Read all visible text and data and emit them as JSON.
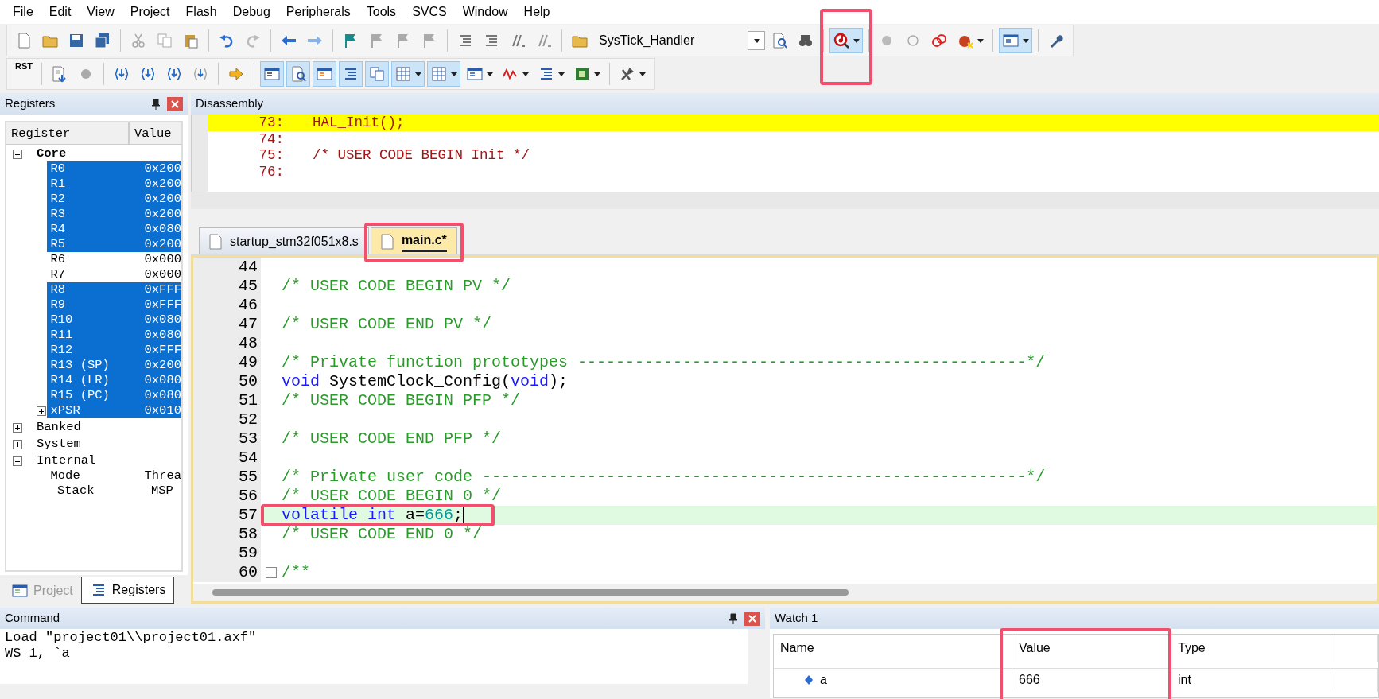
{
  "menu": [
    "File",
    "Edit",
    "View",
    "Project",
    "Flash",
    "Debug",
    "Peripherals",
    "Tools",
    "SVCS",
    "Window",
    "Help"
  ],
  "toolbar_1": [
    {
      "kind": "new"
    },
    {
      "kind": "open"
    },
    {
      "kind": "save"
    },
    {
      "kind": "saveall"
    },
    {
      "kind": "separator"
    },
    {
      "kind": "cut"
    },
    {
      "kind": "copy"
    },
    {
      "kind": "paste"
    },
    {
      "kind": "separator"
    },
    {
      "kind": "undo"
    },
    {
      "kind": "redo"
    },
    {
      "kind": "separator"
    },
    {
      "kind": "back"
    },
    {
      "kind": "forward"
    },
    {
      "kind": "separator"
    },
    {
      "kind": "bookmark"
    },
    {
      "kind": "bookmarkprev"
    },
    {
      "kind": "bookmarknext"
    },
    {
      "kind": "bookmarkclear"
    },
    {
      "kind": "separator"
    },
    {
      "kind": "indent"
    },
    {
      "kind": "outdent"
    },
    {
      "kind": "comment"
    },
    {
      "kind": "uncomment"
    },
    {
      "kind": "separator"
    },
    {
      "kind": "findfiles"
    },
    {
      "kind": "combo",
      "value": "SysTick_Handler"
    },
    {
      "kind": "find"
    },
    {
      "kind": "incremental"
    },
    {
      "kind": "separator"
    },
    {
      "kind": "debug",
      "on": true,
      "dropdown": true,
      "highlighted": true
    },
    {
      "kind": "separator"
    },
    {
      "kind": "bpinsert"
    },
    {
      "kind": "bpenable"
    },
    {
      "kind": "bpdisable"
    },
    {
      "kind": "bpkill",
      "dropdown": true
    },
    {
      "kind": "separator"
    },
    {
      "kind": "layout",
      "on": true,
      "dropdown": true
    },
    {
      "kind": "separator"
    },
    {
      "kind": "wrench"
    }
  ],
  "toolbar_2": [
    {
      "kind": "reset",
      "label": "RST"
    },
    {
      "kind": "separator"
    },
    {
      "kind": "run"
    },
    {
      "kind": "stop"
    },
    {
      "kind": "separator"
    },
    {
      "kind": "stepinto"
    },
    {
      "kind": "stepover"
    },
    {
      "kind": "stepout"
    },
    {
      "kind": "runcursor"
    },
    {
      "kind": "separator"
    },
    {
      "kind": "nextstatement"
    },
    {
      "kind": "separator"
    },
    {
      "kind": "cmdwindow",
      "on": true
    },
    {
      "kind": "disasm",
      "on": true
    },
    {
      "kind": "symbols",
      "on": true
    },
    {
      "kind": "registers",
      "on": true
    },
    {
      "kind": "callstack",
      "on": true
    },
    {
      "kind": "watch",
      "on": true,
      "dropdown": true
    },
    {
      "kind": "memory",
      "on": true,
      "dropdown": true
    },
    {
      "kind": "serial",
      "dropdown": true
    },
    {
      "kind": "analysis",
      "dropdown": true
    },
    {
      "kind": "trace",
      "dropdown": true
    },
    {
      "kind": "sysviewer",
      "dropdown": true
    },
    {
      "kind": "separator"
    },
    {
      "kind": "toolbox",
      "dropdown": true
    }
  ],
  "registers_panel": {
    "title": "Registers",
    "columns": [
      "Register",
      "Value"
    ],
    "tree": [
      {
        "name": "Core",
        "bold": true,
        "expanded": true,
        "children": [
          {
            "name": "R0",
            "value": "0x200",
            "selected": true
          },
          {
            "name": "R1",
            "value": "0x200",
            "selected": true
          },
          {
            "name": "R2",
            "value": "0x200",
            "selected": true
          },
          {
            "name": "R3",
            "value": "0x200",
            "selected": true
          },
          {
            "name": "R4",
            "value": "0x080",
            "selected": true
          },
          {
            "name": "R5",
            "value": "0x200",
            "selected": true
          },
          {
            "name": "R6",
            "value": "0x000",
            "selected": false
          },
          {
            "name": "R7",
            "value": "0x000",
            "selected": false
          },
          {
            "name": "R8",
            "value": "0xFFF",
            "selected": true
          },
          {
            "name": "R9",
            "value": "0xFFF",
            "selected": true
          },
          {
            "name": "R10",
            "value": "0x080",
            "selected": true
          },
          {
            "name": "R11",
            "value": "0x080",
            "selected": true
          },
          {
            "name": "R12",
            "value": "0xFFF",
            "selected": true
          },
          {
            "name": "R13 (SP)",
            "value": "0x200",
            "selected": true
          },
          {
            "name": "R14 (LR)",
            "value": "0x080",
            "selected": true
          },
          {
            "name": "R15 (PC)",
            "value": "0x080",
            "selected": true
          },
          {
            "name": "xPSR",
            "value": "0x010",
            "selected": true,
            "expanded": false
          }
        ]
      },
      {
        "name": "Banked",
        "bold": false,
        "expanded": false
      },
      {
        "name": "System",
        "bold": false,
        "expanded": false
      },
      {
        "name": "Internal",
        "bold": false,
        "expanded": true,
        "children": [
          {
            "name": "Mode",
            "value": "Threa",
            "selected": false
          },
          {
            "name": "Stack",
            "value": "MSP",
            "selected": false
          }
        ]
      }
    ],
    "tabs": [
      {
        "label": "Project",
        "selected": false
      },
      {
        "label": "Registers",
        "selected": true
      }
    ]
  },
  "disassembly": {
    "title": "Disassembly",
    "lines": [
      {
        "number": "73:",
        "code": "HAL_Init();",
        "current": true
      },
      {
        "number": "74:",
        "current": false
      },
      {
        "number": "75:",
        "code": "/* USER CODE BEGIN Init */",
        "current": false
      },
      {
        "number": "76:",
        "current": false
      }
    ]
  },
  "editor_tabs": [
    {
      "label": "startup_stm32f051x8.s",
      "selected": false
    },
    {
      "label": "main.c*",
      "selected": true,
      "highlighted": true
    }
  ],
  "editor": {
    "lines": [
      {
        "number": "44",
        "current": false,
        "fold": false
      },
      {
        "number": "45",
        "tokens": [
          {
            "kind": "comment",
            "text": "/* USER CODE BEGIN PV */"
          }
        ],
        "current": false,
        "fold": false
      },
      {
        "number": "46",
        "current": false,
        "fold": false
      },
      {
        "number": "47",
        "tokens": [
          {
            "kind": "comment",
            "text": "/* USER CODE END PV */"
          }
        ],
        "current": false,
        "fold": false
      },
      {
        "number": "48",
        "current": false,
        "fold": false
      },
      {
        "number": "49",
        "tokens": [
          {
            "kind": "comment",
            "text": "/* Private function prototypes -----------------------------------------------*/"
          }
        ],
        "current": false,
        "fold": false
      },
      {
        "number": "50",
        "tokens": [
          {
            "kind": "keyword",
            "text": "void"
          },
          {
            "kind": "plain",
            "text": " SystemClock_Config("
          },
          {
            "kind": "keyword",
            "text": "void"
          },
          {
            "kind": "plain",
            "text": ");"
          }
        ],
        "current": false,
        "fold": false
      },
      {
        "number": "51",
        "tokens": [
          {
            "kind": "comment",
            "text": "/* USER CODE BEGIN PFP */"
          }
        ],
        "current": false,
        "fold": false
      },
      {
        "number": "52",
        "current": false,
        "fold": false
      },
      {
        "number": "53",
        "tokens": [
          {
            "kind": "comment",
            "text": "/* USER CODE END PFP */"
          }
        ],
        "current": false,
        "fold": false
      },
      {
        "number": "54",
        "current": false,
        "fold": false
      },
      {
        "number": "55",
        "tokens": [
          {
            "kind": "comment",
            "text": "/* Private user code ---------------------------------------------------------*/"
          }
        ],
        "current": false,
        "fold": false
      },
      {
        "number": "56",
        "tokens": [
          {
            "kind": "comment",
            "text": "/* USER CODE BEGIN 0 */"
          }
        ],
        "current": false,
        "fold": false
      },
      {
        "number": "57",
        "tokens": [
          {
            "kind": "keyword",
            "text": "volatile int"
          },
          {
            "kind": "plain",
            "text": " a="
          },
          {
            "kind": "number",
            "text": "666"
          },
          {
            "kind": "plain",
            "text": ";"
          }
        ],
        "current": true,
        "highlighted": true,
        "fold": false
      },
      {
        "number": "58",
        "tokens": [
          {
            "kind": "comment",
            "text": "/* USER CODE END 0 */"
          }
        ],
        "current": false,
        "fold": false
      },
      {
        "number": "59",
        "current": false,
        "fold": false
      },
      {
        "number": "60",
        "tokens": [
          {
            "kind": "comment",
            "text": "/**"
          }
        ],
        "current": false,
        "fold": true
      }
    ]
  },
  "command": {
    "title": "Command",
    "lines": [
      "Load \"project01\\\\project01.axf\"",
      "WS 1, `a"
    ]
  },
  "watch": {
    "title": "Watch 1",
    "columns": [
      {
        "label": "Name"
      },
      {
        "label": "Value",
        "highlighted": true
      },
      {
        "label": "Type"
      }
    ],
    "rows": [
      {
        "name": "a",
        "value": "666",
        "type": "int"
      }
    ]
  }
}
